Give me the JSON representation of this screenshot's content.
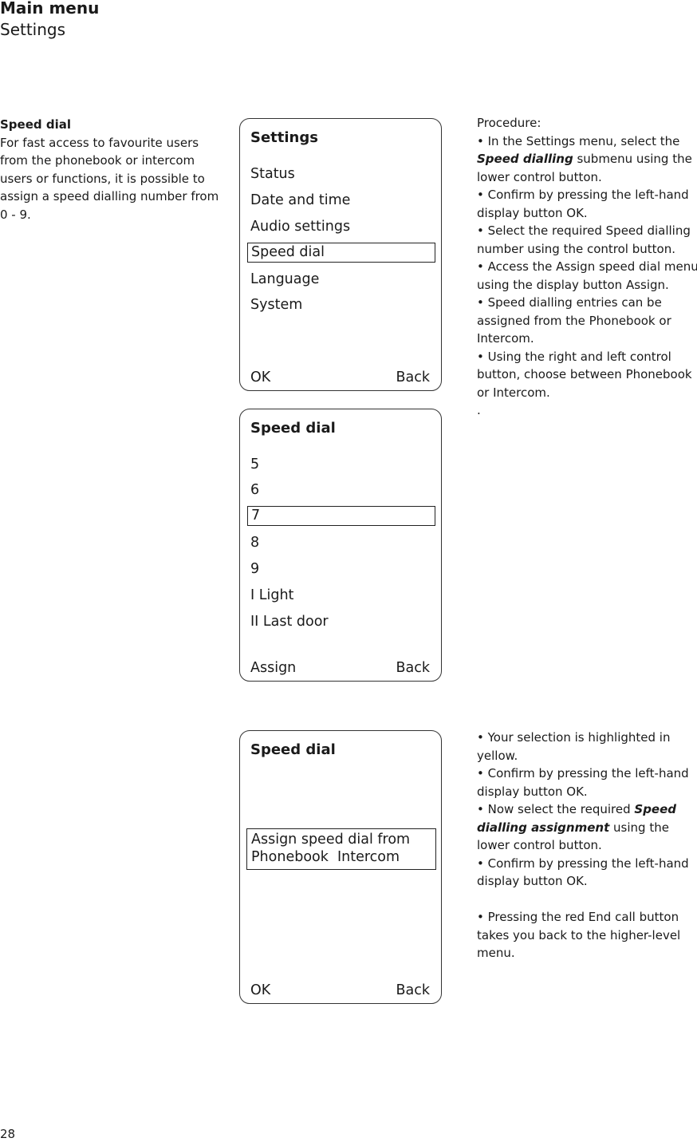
{
  "header": {
    "title": "Main menu",
    "subtitle": "Settings"
  },
  "intro": {
    "title": "Speed dial",
    "text": "For fast access to favourite users from the phonebook or intercom users or functions, it is possible to assign a speed dialling number from 0 - 9."
  },
  "screens": [
    {
      "title": "Settings",
      "items": [
        "Status",
        "Date and time",
        "Audio settings",
        "Speed dial",
        "Language",
        "System"
      ],
      "selected_index": 3,
      "soft_left": "OK",
      "soft_right": "Back"
    },
    {
      "title": "Speed dial",
      "items": [
        "5",
        "6",
        "7",
        "8",
        "9",
        "I Light",
        "II Last door"
      ],
      "selected_index": 2,
      "soft_left": "Assign",
      "soft_right": "Back"
    },
    {
      "title": "Speed dial",
      "message_line1": "Assign speed dial from",
      "message_line2": "Phonebook  Intercom",
      "soft_left": "OK",
      "soft_right": "Back"
    }
  ],
  "procedure1": {
    "heading": "Procedure:",
    "b1_pre": "• In the Settings menu, select the ",
    "b1_bold": "Speed dialling",
    "b1_post": " submenu using the lower control button.",
    "b2": "• Confirm by pressing the left-hand display button OK.",
    "b3": "• Select the required Speed dialling number using the control button.",
    "b4": "• Access the Assign speed dial menu using the display button Assign.",
    "b5": "• Speed dialling entries can be assigned from the Phonebook or Intercom.",
    "b6": "• Using the right and left control button, choose between Phonebook or Intercom.",
    "trailing": "."
  },
  "procedure2": {
    "b1": "• Your selection is highlighted in yellow.",
    "b2": "• Confirm by pressing the left-hand display button OK.",
    "b3_pre": "• Now select the required ",
    "b3_bold": "Speed dialling assignment",
    "b3_post": " using the lower control button.",
    "b4": "• Confirm by pressing the left-hand display button OK.",
    "b5": "• Pressing the red End call button takes you back to the higher-level menu."
  },
  "page_number": "28"
}
